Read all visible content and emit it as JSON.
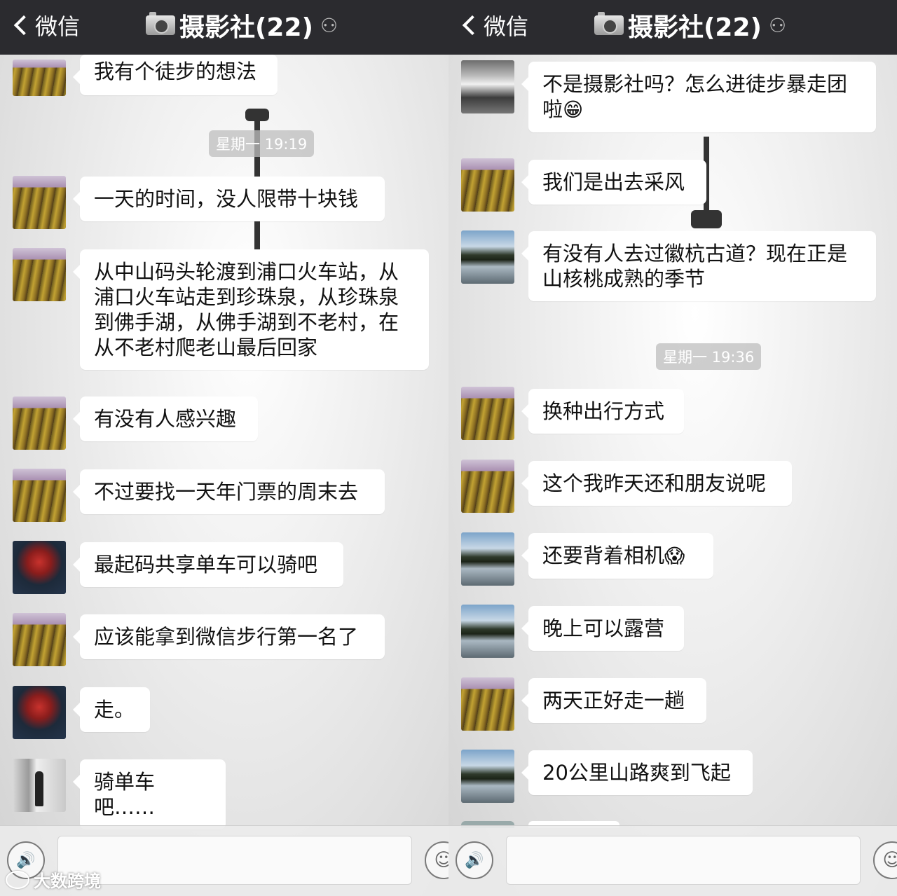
{
  "left": {
    "header": {
      "back_label": "微信",
      "title": "摄影社(22)",
      "ear_icon": "earpiece-icon"
    },
    "timestamp": "星期一 19:19",
    "messages": [
      {
        "avatar": "vineyard-avatar",
        "text": "我有个徒步的想法"
      },
      {
        "avatar": "vineyard-avatar",
        "text": "一天的时间，没人限带十块钱"
      },
      {
        "avatar": "vineyard-avatar",
        "text": "从中山码头轮渡到浦口火车站，从浦口火车站走到珍珠泉，从珍珠泉到佛手湖，从佛手湖到不老村，在从不老村爬老山最后回家"
      },
      {
        "avatar": "vineyard-avatar",
        "text": "有没有人感兴趣"
      },
      {
        "avatar": "vineyard-avatar",
        "text": "不过要找一天年门票的周末去"
      },
      {
        "avatar": "hero-avatar",
        "text": "最起码共享单车可以骑吧"
      },
      {
        "avatar": "vineyard-avatar",
        "text": "应该能拿到微信步行第一名了"
      },
      {
        "avatar": "hero-avatar",
        "text": "走。"
      },
      {
        "avatar": "person-avatar",
        "text": "骑单车吧……"
      }
    ]
  },
  "right": {
    "header": {
      "back_label": "微信",
      "title": "摄影社(22)",
      "ear_icon": "earpiece-icon"
    },
    "timestamp": "星期一 19:36",
    "messages": [
      {
        "avatar": "car-avatar",
        "text": "不是摄影社吗？怎么进徒步暴走团啦",
        "emoji": "😁"
      },
      {
        "avatar": "vineyard-avatar",
        "text": "我们是出去采风"
      },
      {
        "avatar": "lake-avatar",
        "text": "有没有人去过徽杭古道？现在正是山核桃成熟的季节"
      },
      {
        "avatar": "vineyard-avatar",
        "text": "换种出行方式"
      },
      {
        "avatar": "vineyard-avatar",
        "text": "这个我昨天还和朋友说呢"
      },
      {
        "avatar": "lake-avatar",
        "text": "还要背着相机",
        "emoji": "😱"
      },
      {
        "avatar": "lake-avatar",
        "text": "晚上可以露营"
      },
      {
        "avatar": "vineyard-avatar",
        "text": "两天正好走一趟"
      },
      {
        "avatar": "lake-avatar",
        "text": "20公里山路爽到飞起"
      }
    ]
  },
  "input_bar": {
    "voice_icon": "voice-icon",
    "emoji_icon": "emoji-icon"
  },
  "watermark": "大数跨境",
  "colors": {
    "navbar": "#2b2b2f",
    "bubble": "#ffffff",
    "background": "#e8e8e8"
  }
}
